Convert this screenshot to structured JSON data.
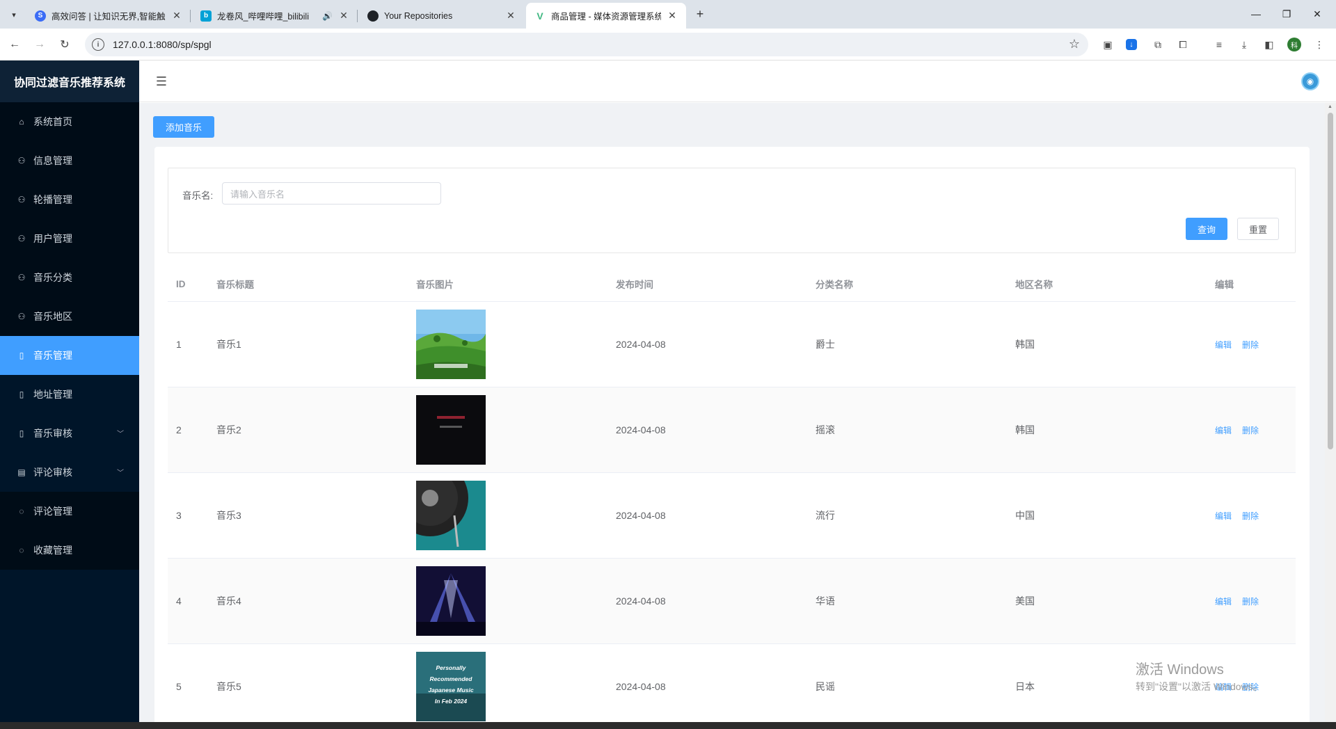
{
  "browser": {
    "tabs": [
      {
        "title": "高效问答 | 让知识无界,智能触手",
        "favicon_color": "#3b6cf6",
        "favicon_glyph": "S",
        "active": false,
        "audio": false
      },
      {
        "title": "龙卷风_哔哩哔哩_bilibili",
        "favicon_color": "#00a1d6",
        "favicon_glyph": "b",
        "active": false,
        "audio": true
      },
      {
        "title": "Your Repositories",
        "favicon_color": "#1f2328",
        "favicon_glyph": "gh",
        "active": false,
        "audio": false
      },
      {
        "title": "商品管理 - 媒体资源管理系统",
        "favicon_color": "#41b883",
        "favicon_glyph": "V",
        "active": true,
        "audio": false
      }
    ],
    "url": "127.0.0.1:8080/sp/spgl",
    "profile_initial": "科",
    "icons": [
      "back-icon",
      "forward-icon",
      "reload-icon",
      "site-info-icon",
      "star-icon",
      "extensions-icon",
      "download-icon",
      "menu-icon"
    ]
  },
  "sidebar": {
    "brand": "协同过滤音乐推荐系统",
    "items": [
      {
        "label": "系统首页",
        "icon": "home-icon",
        "active": false,
        "expandable": false
      },
      {
        "label": "信息管理",
        "icon": "user-icon",
        "active": false,
        "expandable": false
      },
      {
        "label": "轮播管理",
        "icon": "user-icon",
        "active": false,
        "expandable": false
      },
      {
        "label": "用户管理",
        "icon": "user-icon",
        "active": false,
        "expandable": false
      },
      {
        "label": "音乐分类",
        "icon": "user-icon",
        "active": false,
        "expandable": false
      },
      {
        "label": "音乐地区",
        "icon": "user-icon",
        "active": false,
        "expandable": false
      },
      {
        "label": "音乐管理",
        "icon": "book-icon",
        "active": true,
        "expandable": false
      },
      {
        "label": "地址管理",
        "icon": "book-icon",
        "active": false,
        "expandable": false
      },
      {
        "label": "音乐审核",
        "icon": "book-icon",
        "active": false,
        "expandable": true
      },
      {
        "label": "评论审核",
        "icon": "document-icon",
        "active": false,
        "expandable": true
      },
      {
        "label": "评论管理",
        "icon": "chat-icon",
        "active": false,
        "expandable": false
      },
      {
        "label": "收藏管理",
        "icon": "chat-icon",
        "active": false,
        "expandable": false
      }
    ],
    "colors": {
      "background": "#001529",
      "active": "#409eff"
    }
  },
  "toolbar": {
    "add_label": "添加音乐"
  },
  "search": {
    "label": "音乐名:",
    "placeholder": "请输入音乐名",
    "query_label": "查询",
    "reset_label": "重置"
  },
  "table": {
    "headers": [
      "ID",
      "音乐标题",
      "音乐图片",
      "发布时间",
      "分类名称",
      "地区名称",
      "编辑"
    ],
    "rows": [
      {
        "id": "1",
        "title": "音乐1",
        "image": "green-hills-cover",
        "date": "2024-04-08",
        "category": "爵士",
        "region": "韩国",
        "edit": "编辑",
        "delete": "删除"
      },
      {
        "id": "2",
        "title": "音乐2",
        "image": "dark-text-cover",
        "date": "2024-04-08",
        "category": "摇滚",
        "region": "韩国",
        "edit": "编辑",
        "delete": "删除"
      },
      {
        "id": "3",
        "title": "音乐3",
        "image": "vinyl-record-cover",
        "date": "2024-04-08",
        "category": "流行",
        "region": "中国",
        "edit": "编辑",
        "delete": "删除"
      },
      {
        "id": "4",
        "title": "音乐4",
        "image": "concert-lights-cover",
        "date": "2024-04-08",
        "category": "华语",
        "region": "美国",
        "edit": "编辑",
        "delete": "删除"
      },
      {
        "id": "5",
        "title": "音乐5",
        "image": "recommended-japanese-cover",
        "date": "2024-04-08",
        "category": "民谣",
        "region": "日本",
        "edit": "编辑",
        "delete": "删除"
      }
    ]
  },
  "covers": {
    "recommended_text": [
      "Personally",
      "Recommended",
      "Japanese Music",
      "In Feb 2024"
    ]
  },
  "watermark": {
    "line1": "激活 Windows",
    "line2": "转到\"设置\"以激活 Windows。"
  },
  "accent_color": "#409eff"
}
